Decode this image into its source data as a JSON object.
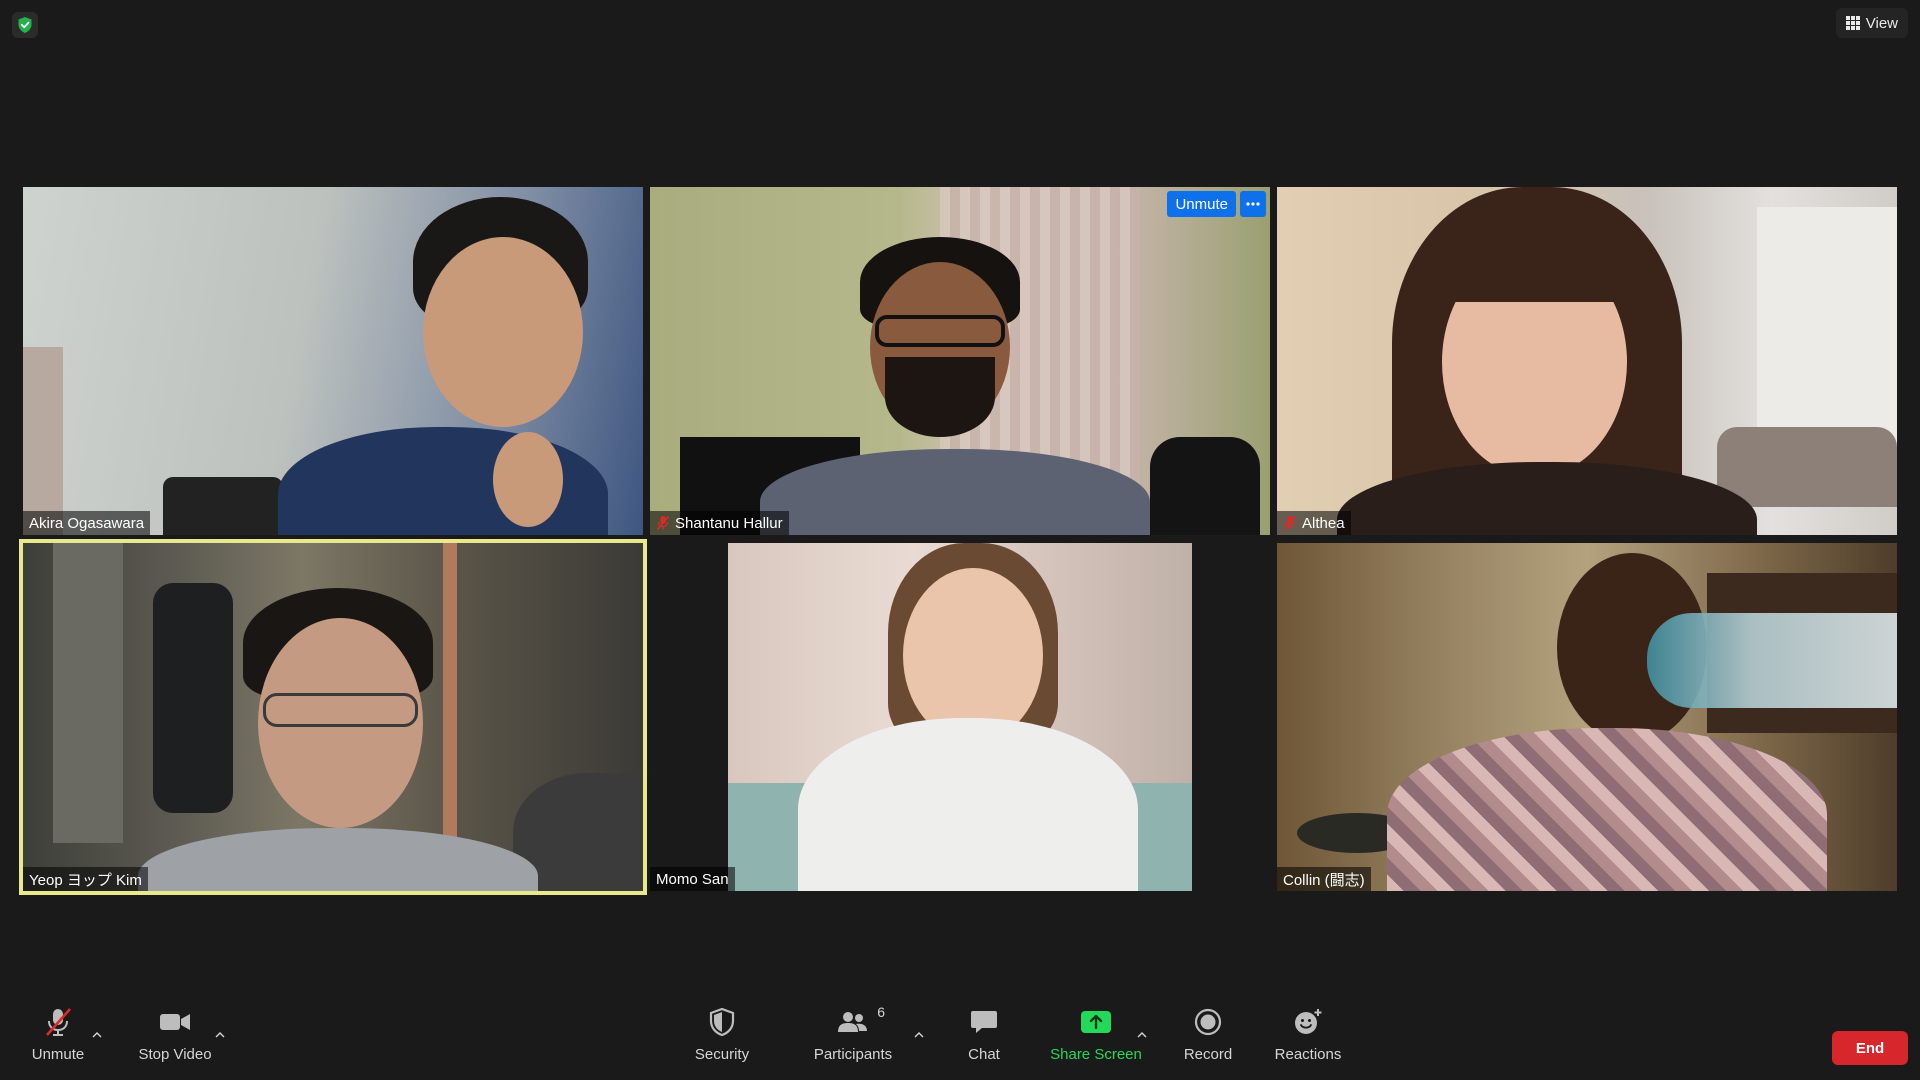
{
  "top": {
    "view_label": "View",
    "security_icon": "shield-check-icon"
  },
  "participants": [
    {
      "name": "Akira Ogasawara",
      "muted": false
    },
    {
      "name": "Shantanu Hallur",
      "muted": true
    },
    {
      "name": "Althea",
      "muted": true
    },
    {
      "name": "Yeop ヨップ Kim",
      "muted": false,
      "active_speaker": true
    },
    {
      "name": "Momo San",
      "muted": false
    },
    {
      "name": "Collin (闘志)",
      "muted": false
    }
  ],
  "tile_actions": {
    "unmute_label": "Unmute",
    "more_icon": "ellipsis-icon"
  },
  "toolbar": {
    "unmute_label": "Unmute",
    "stop_video_label": "Stop Video",
    "security_label": "Security",
    "participants_label": "Participants",
    "participants_count": "6",
    "chat_label": "Chat",
    "share_screen_label": "Share Screen",
    "record_label": "Record",
    "reactions_label": "Reactions",
    "end_label": "End"
  },
  "colors": {
    "background": "#1a1a1a",
    "accent_blue": "#0e71eb",
    "share_green": "#23d959",
    "end_red": "#d7262c",
    "active_speaker_border": "#e8e98a",
    "muted_red": "#e02828"
  }
}
